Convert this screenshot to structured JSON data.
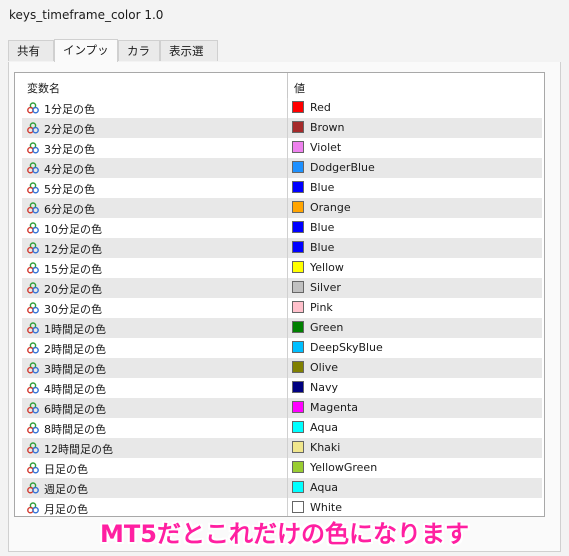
{
  "window": {
    "title": "keys_timeframe_color 1.0"
  },
  "tabs": [
    {
      "label": "共有",
      "active": false
    },
    {
      "label": "インプット",
      "active": true
    },
    {
      "label": "カラー",
      "active": false
    },
    {
      "label": "表示選択",
      "active": false
    }
  ],
  "table": {
    "headers": {
      "name": "変数名",
      "value": "値"
    },
    "row_icon": "input-parameter-icon",
    "rows": [
      {
        "name": "1分足の色",
        "value": "Red",
        "color": "#ff0000"
      },
      {
        "name": "2分足の色",
        "value": "Brown",
        "color": "#a52a2a"
      },
      {
        "name": "3分足の色",
        "value": "Violet",
        "color": "#ee82ee"
      },
      {
        "name": "4分足の色",
        "value": "DodgerBlue",
        "color": "#1e90ff"
      },
      {
        "name": "5分足の色",
        "value": "Blue",
        "color": "#0000ff"
      },
      {
        "name": "6分足の色",
        "value": "Orange",
        "color": "#ffa500"
      },
      {
        "name": "10分足の色",
        "value": "Blue",
        "color": "#0000ff"
      },
      {
        "name": "12分足の色",
        "value": "Blue",
        "color": "#0000ff"
      },
      {
        "name": "15分足の色",
        "value": "Yellow",
        "color": "#ffff00"
      },
      {
        "name": "20分足の色",
        "value": "Silver",
        "color": "#c0c0c0"
      },
      {
        "name": "30分足の色",
        "value": "Pink",
        "color": "#ffc0cb"
      },
      {
        "name": "1時間足の色",
        "value": "Green",
        "color": "#008000"
      },
      {
        "name": "2時間足の色",
        "value": "DeepSkyBlue",
        "color": "#00bfff"
      },
      {
        "name": "3時間足の色",
        "value": "Olive",
        "color": "#808000"
      },
      {
        "name": "4時間足の色",
        "value": "Navy",
        "color": "#000080"
      },
      {
        "name": "6時間足の色",
        "value": "Magenta",
        "color": "#ff00ff"
      },
      {
        "name": "8時間足の色",
        "value": "Aqua",
        "color": "#00ffff"
      },
      {
        "name": "12時間足の色",
        "value": "Khaki",
        "color": "#f0e68c"
      },
      {
        "name": "日足の色",
        "value": "YellowGreen",
        "color": "#9acd32"
      },
      {
        "name": "週足の色",
        "value": "Aqua",
        "color": "#00ffff"
      },
      {
        "name": "月足の色",
        "value": "White",
        "color": "#ffffff"
      }
    ]
  },
  "annotation": {
    "text": "MT5だとこれだけの色になります",
    "color": "#ff1fa1"
  }
}
